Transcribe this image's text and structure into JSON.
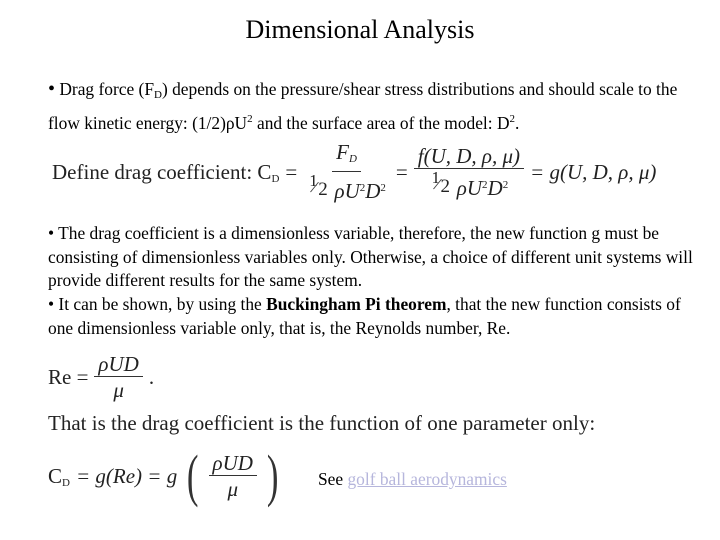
{
  "title": "Dimensional Analysis",
  "paragraphs": {
    "p1": {
      "bullet": "•",
      "t1": " Drag force (F",
      "sub1": "D",
      "t2": ") depends on the pressure/shear stress distributions and should scale to the flow kinetic energy: (1/2)ρU",
      "sup1": "2",
      "t3": " and the surface area of the model: D",
      "sup2": "2",
      "t4": "."
    },
    "p2": {
      "text": "• The drag coefficient is a dimensionless variable, therefore, the new function g must be consisting of dimensionless variables only.  Otherwise, a choice of different unit systems will provide different results for the same system."
    },
    "p3": {
      "t1": "• It can be shown, by using the ",
      "bold": "Buckingham Pi theorem",
      "t2": ", that the new function consists of one dimensionless variable only, that is, the Reynolds number, Re."
    }
  },
  "equations": {
    "define": {
      "label": "Define drag coefficient: C",
      "label_sub": "D",
      "eq": "=",
      "num1": "F",
      "num1_sub": "D",
      "den_rho": "ρU",
      "den_sup1": "2",
      "den_D": "D",
      "den_sup2": "2",
      "num2": "f(U, D, ρ, μ)",
      "rhs": "= g(U, D, ρ, μ)"
    },
    "reynolds": {
      "lhs": "Re =",
      "num": "ρUD",
      "den": "μ",
      "tail": "."
    },
    "sentence": "That is the drag coefficient is the function of one parameter only:",
    "cd": {
      "lhs": "C",
      "lhs_sub": "D",
      "mid": "= g(Re) = g",
      "num": "ρUD",
      "den": "μ"
    }
  },
  "see": {
    "label": "See",
    "link_text": "golf ball aerodynamics",
    "link_color": "#b6b6dc"
  }
}
